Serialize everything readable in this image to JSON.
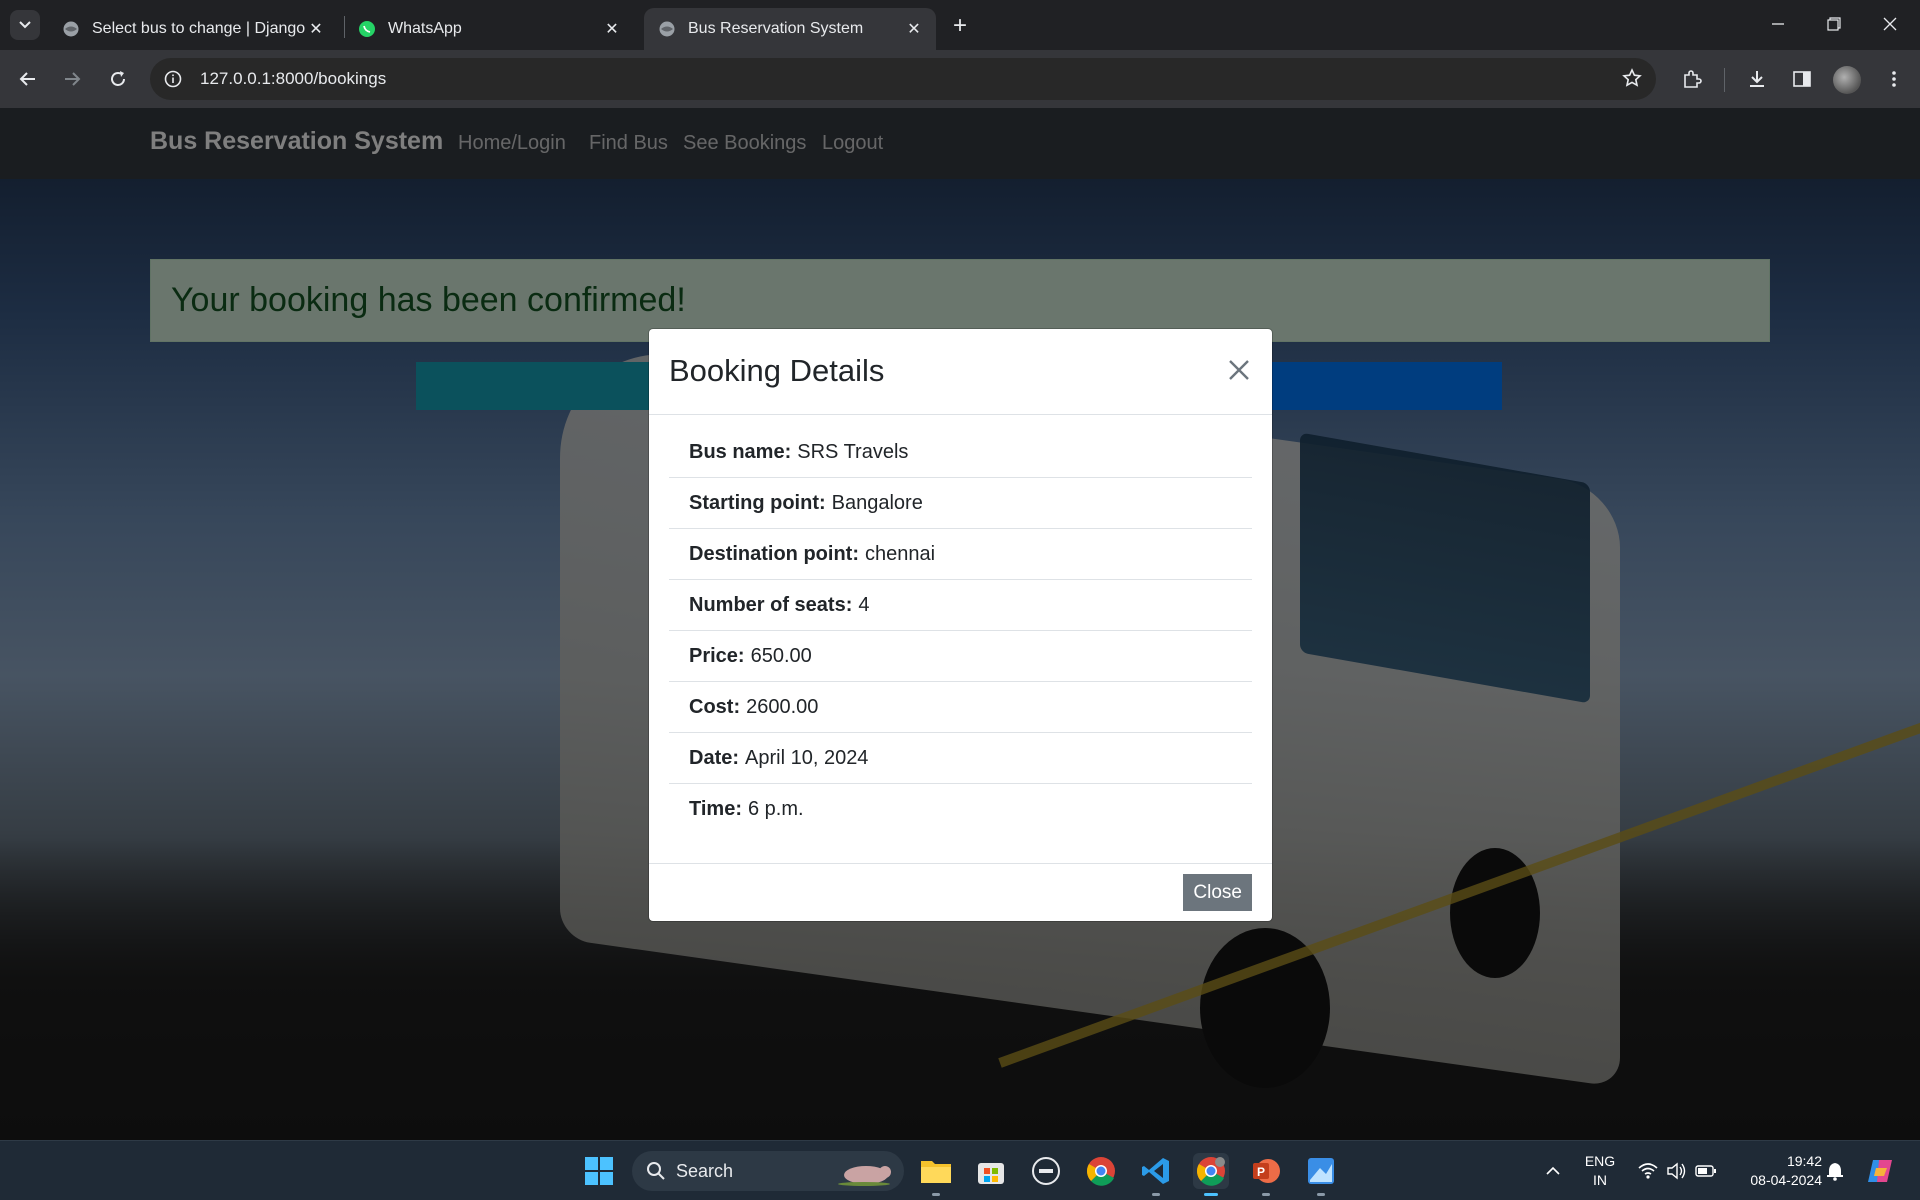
{
  "browser": {
    "tabs": [
      {
        "title": "Select bus to change | Django s",
        "favicon": "globe-icon",
        "active": false
      },
      {
        "title": "WhatsApp",
        "favicon": "whatsapp-icon",
        "active": false
      },
      {
        "title": "Bus Reservation System",
        "favicon": "globe-icon",
        "active": true
      }
    ],
    "url": "127.0.0.1:8000/bookings"
  },
  "navbar": {
    "brand": "Bus Reservation System",
    "links": [
      "Home/Login",
      "Find Bus",
      "See Bookings",
      "Logout"
    ]
  },
  "alert": {
    "message": "Your booking has been confirmed!"
  },
  "modal": {
    "title": "Booking Details",
    "details": [
      {
        "label": "Bus name:",
        "value": "SRS Travels"
      },
      {
        "label": "Starting point:",
        "value": "Bangalore"
      },
      {
        "label": "Destination point:",
        "value": "chennai"
      },
      {
        "label": "Number of seats:",
        "value": "4"
      },
      {
        "label": "Price:",
        "value": "650.00"
      },
      {
        "label": "Cost:",
        "value": "2600.00"
      },
      {
        "label": "Date:",
        "value": "April 10, 2024"
      },
      {
        "label": "Time:",
        "value": "6 p.m."
      }
    ],
    "close_label": "Close"
  },
  "taskbar": {
    "search_label": "Search",
    "lang_line1": "ENG",
    "lang_line2": "IN",
    "time": "19:42",
    "date": "08-04-2024"
  },
  "colors": {
    "navbar_bg": "#343a40",
    "alert_bg": "#d4edda",
    "alert_text": "#155724",
    "btn_secondary": "#6c757d",
    "btn_info": "#17a2b8",
    "btn_primary": "#007bff"
  }
}
